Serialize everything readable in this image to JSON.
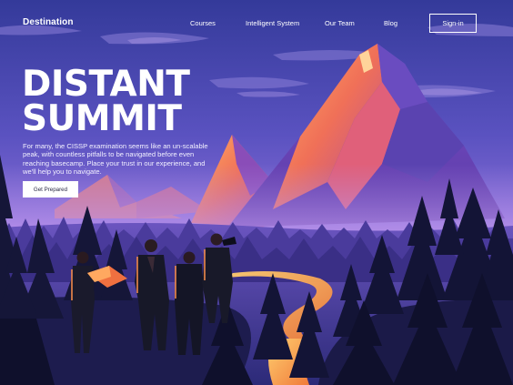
{
  "nav": {
    "brand": "Destination",
    "items": [
      {
        "label": "Courses"
      },
      {
        "label": "Intelligent System"
      },
      {
        "label": "Our Team"
      },
      {
        "label": "Blog"
      }
    ],
    "signin_label": "Sign-in"
  },
  "hero": {
    "title_line1": "DISTANT",
    "title_line2": "SUMMIT",
    "description": "For many, the CISSP examination seems like an un-scalable peak, with countless pitfalls to be navigated before even reaching basecamp. Place your trust in our experience, and we'll help you to navigate.",
    "cta_label": "Get Prepared"
  },
  "colors": {
    "sky_top": "#3a3fa0",
    "sky_mid": "#6a5cc8",
    "peak_orange": "#f08a4b",
    "peak_pink": "#e2607a",
    "forest": "#1b1d4a",
    "river": "#f5a13a"
  }
}
